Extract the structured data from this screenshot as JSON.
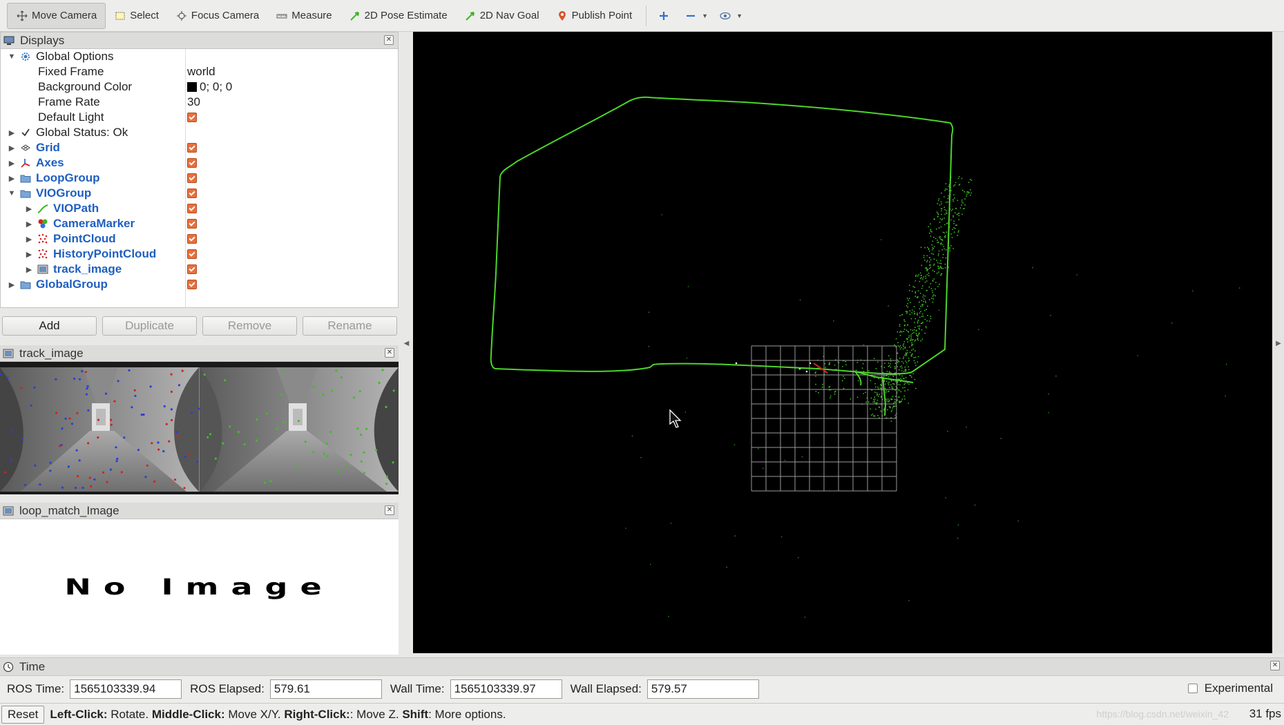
{
  "toolbar": {
    "move_camera": "Move Camera",
    "select": "Select",
    "focus_camera": "Focus Camera",
    "measure": "Measure",
    "pose_estimate": "2D Pose Estimate",
    "nav_goal": "2D Nav Goal",
    "publish_point": "Publish Point"
  },
  "displays": {
    "title": "Displays",
    "global_options": "Global Options",
    "fixed_frame_label": "Fixed Frame",
    "fixed_frame_value": "world",
    "bg_color_label": "Background Color",
    "bg_color_value": "0; 0; 0",
    "frame_rate_label": "Frame Rate",
    "frame_rate_value": "30",
    "default_light_label": "Default Light",
    "global_status": "Global Status: Ok",
    "items": [
      "Grid",
      "Axes",
      "LoopGroup",
      "VIOGroup",
      "VIOPath",
      "CameraMarker",
      "PointCloud",
      "HistoryPointCloud",
      "track_image",
      "GlobalGroup"
    ]
  },
  "buttons": {
    "add": "Add",
    "duplicate": "Duplicate",
    "remove": "Remove",
    "rename": "Rename"
  },
  "track_panel": {
    "title": "track_image"
  },
  "loop_panel": {
    "title": "loop_match_Image",
    "placeholder": "No Image"
  },
  "time": {
    "title": "Time",
    "ros_time_label": "ROS Time:",
    "ros_time_value": "1565103339.94",
    "ros_elapsed_label": "ROS Elapsed:",
    "ros_elapsed_value": "579.61",
    "wall_time_label": "Wall Time:",
    "wall_time_value": "1565103339.97",
    "wall_elapsed_label": "Wall Elapsed:",
    "wall_elapsed_value": "579.57",
    "experimental": "Experimental"
  },
  "status": {
    "reset": "Reset",
    "left_click": "Left-Click:",
    "left_action": "Rotate.",
    "middle_click": "Middle-Click:",
    "middle_action": "Move X/Y.",
    "right_click": "Right-Click:",
    "right_action": ": Move Z.",
    "shift": "Shift",
    "shift_action": ": More options.",
    "watermark": "https://blog.csdn.net/weixin_42",
    "fps": "31 fps"
  },
  "colors": {
    "path": "#4cd62a",
    "check": "#e8703c",
    "link_blue": "#1f5fbf",
    "viewport_bg": "#000000"
  }
}
